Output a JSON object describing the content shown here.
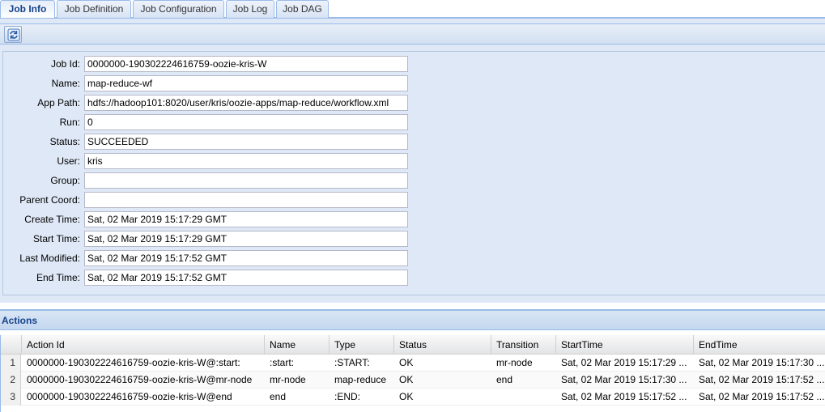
{
  "tabs": [
    "Job Info",
    "Job Definition",
    "Job Configuration",
    "Job Log",
    "Job DAG"
  ],
  "toolbar": {
    "refresh_icon": "refresh-icon"
  },
  "job_info": {
    "fields": [
      {
        "label": "Job Id:",
        "value": "0000000-190302224616759-oozie-kris-W"
      },
      {
        "label": "Name:",
        "value": "map-reduce-wf"
      },
      {
        "label": "App Path:",
        "value": "hdfs://hadoop101:8020/user/kris/oozie-apps/map-reduce/workflow.xml"
      },
      {
        "label": "Run:",
        "value": "0"
      },
      {
        "label": "Status:",
        "value": "SUCCEEDED"
      },
      {
        "label": "User:",
        "value": "kris"
      },
      {
        "label": "Group:",
        "value": ""
      },
      {
        "label": "Parent Coord:",
        "value": ""
      },
      {
        "label": "Create Time:",
        "value": "Sat, 02 Mar 2019 15:17:29 GMT"
      },
      {
        "label": "Start Time:",
        "value": "Sat, 02 Mar 2019 15:17:29 GMT"
      },
      {
        "label": "Last Modified:",
        "value": "Sat, 02 Mar 2019 15:17:52 GMT"
      },
      {
        "label": "End Time:",
        "value": "Sat, 02 Mar 2019 15:17:52 GMT"
      }
    ]
  },
  "actions": {
    "title": "Actions",
    "columns": [
      "Action Id",
      "Name",
      "Type",
      "Status",
      "Transition",
      "StartTime",
      "EndTime"
    ],
    "rows": [
      {
        "n": "1",
        "cells": [
          "0000000-190302224616759-oozie-kris-W@:start:",
          ":start:",
          ":START:",
          "OK",
          "mr-node",
          "Sat, 02 Mar 2019 15:17:29 ...",
          "Sat, 02 Mar 2019 15:17:30 ..."
        ]
      },
      {
        "n": "2",
        "cells": [
          "0000000-190302224616759-oozie-kris-W@mr-node",
          "mr-node",
          "map-reduce",
          "OK",
          "end",
          "Sat, 02 Mar 2019 15:17:30 ...",
          "Sat, 02 Mar 2019 15:17:52 ..."
        ]
      },
      {
        "n": "3",
        "cells": [
          "0000000-190302224616759-oozie-kris-W@end",
          "end",
          ":END:",
          "OK",
          "",
          "Sat, 02 Mar 2019 15:17:52 ...",
          "Sat, 02 Mar 2019 15:17:52 ..."
        ]
      }
    ]
  }
}
